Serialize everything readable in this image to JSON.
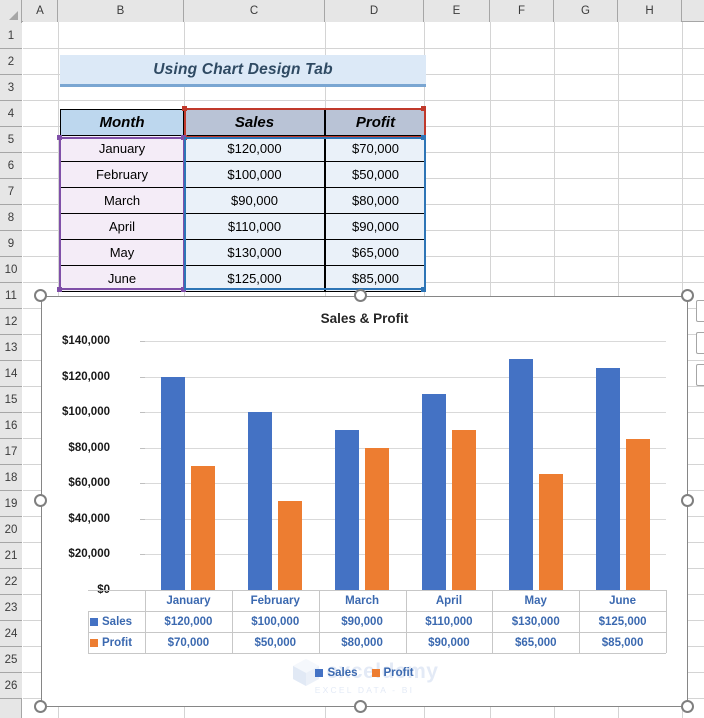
{
  "spreadsheet": {
    "columns": [
      "A",
      "B",
      "C",
      "D",
      "E",
      "F",
      "G",
      "H"
    ],
    "rows": [
      "1",
      "2",
      "3",
      "4",
      "5",
      "6",
      "7",
      "8",
      "9",
      "10",
      "11",
      "12",
      "13",
      "14",
      "15",
      "16",
      "17",
      "18",
      "19",
      "20",
      "21",
      "22",
      "23",
      "24",
      "25",
      "26"
    ],
    "banner_title": "Using Chart Design Tab",
    "table": {
      "headers": [
        "Month",
        "Sales",
        "Profit"
      ],
      "rows": [
        {
          "month": "January",
          "sales": "$120,000",
          "profit": "$70,000"
        },
        {
          "month": "February",
          "sales": "$100,000",
          "profit": "$50,000"
        },
        {
          "month": "March",
          "sales": "$90,000",
          "profit": "$80,000"
        },
        {
          "month": "April",
          "sales": "$110,000",
          "profit": "$90,000"
        },
        {
          "month": "May",
          "sales": "$130,000",
          "profit": "$65,000"
        },
        {
          "month": "June",
          "sales": "$125,000",
          "profit": "$85,000"
        }
      ]
    }
  },
  "chart_data": {
    "type": "bar",
    "title": "Sales & Profit",
    "xlabel": "",
    "ylabel": "",
    "categories": [
      "January",
      "February",
      "March",
      "April",
      "May",
      "June"
    ],
    "series": [
      {
        "name": "Sales",
        "color": "#4472C4",
        "values": [
          120000,
          100000,
          90000,
          110000,
          130000,
          125000
        ],
        "labels": [
          "$120,000",
          "$100,000",
          "$90,000",
          "$110,000",
          "$130,000",
          "$125,000"
        ]
      },
      {
        "name": "Profit",
        "color": "#ED7D31",
        "values": [
          70000,
          50000,
          80000,
          90000,
          65000,
          85000
        ],
        "labels": [
          "$70,000",
          "$50,000",
          "$80,000",
          "$90,000",
          "$65,000",
          "$85,000"
        ]
      }
    ],
    "ylim": [
      0,
      140000
    ],
    "ytick_values": [
      0,
      20000,
      40000,
      60000,
      80000,
      100000,
      120000,
      140000
    ],
    "ytick_labels": [
      "$0",
      "$20,000",
      "$40,000",
      "$60,000",
      "$80,000",
      "$100,000",
      "$120,000",
      "$140,000"
    ],
    "grid": true,
    "legend_position": "bottom",
    "data_table_visible": true
  },
  "watermark": {
    "brand": "exceldemy",
    "tagline": "EXCEL  DATA - BI"
  },
  "selection": {
    "sales_profit_header_color": "#C0392B",
    "month_range_color": "#7F4FA8",
    "value_range_color": "#2E75B6"
  },
  "chart_buttons": [
    {
      "name": "chart-elements-button"
    },
    {
      "name": "chart-styles-button"
    },
    {
      "name": "chart-filters-button"
    }
  ]
}
